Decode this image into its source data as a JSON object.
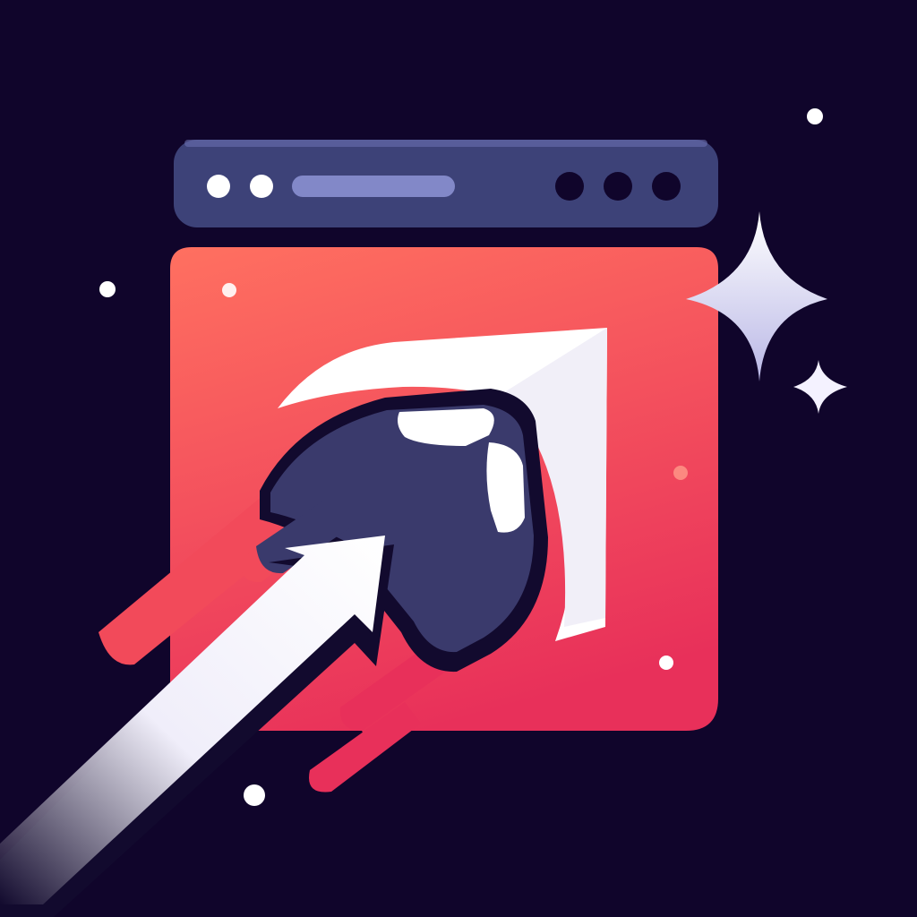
{
  "illustration": {
    "subject": "browser-window-swipe-icon",
    "colors": {
      "background": "#10052b",
      "toolbar": "#3d4278",
      "toolbar_highlight": "#6a6fb0",
      "address_bar": "#8288c8",
      "window_gradient_top": "#ff7060",
      "window_gradient_bottom": "#e8305a",
      "hand": "#3a3a6c",
      "hand_outline": "#120a2e",
      "white": "#ffffff",
      "star": "#f4f2ff"
    },
    "toolbar": {
      "left_dots": 2,
      "right_dots": 3,
      "address_bar_visible": true
    },
    "icons": [
      "browser-window-icon",
      "hand-icon",
      "arrow-icon",
      "page-curl-icon",
      "sparkle-icon"
    ]
  }
}
